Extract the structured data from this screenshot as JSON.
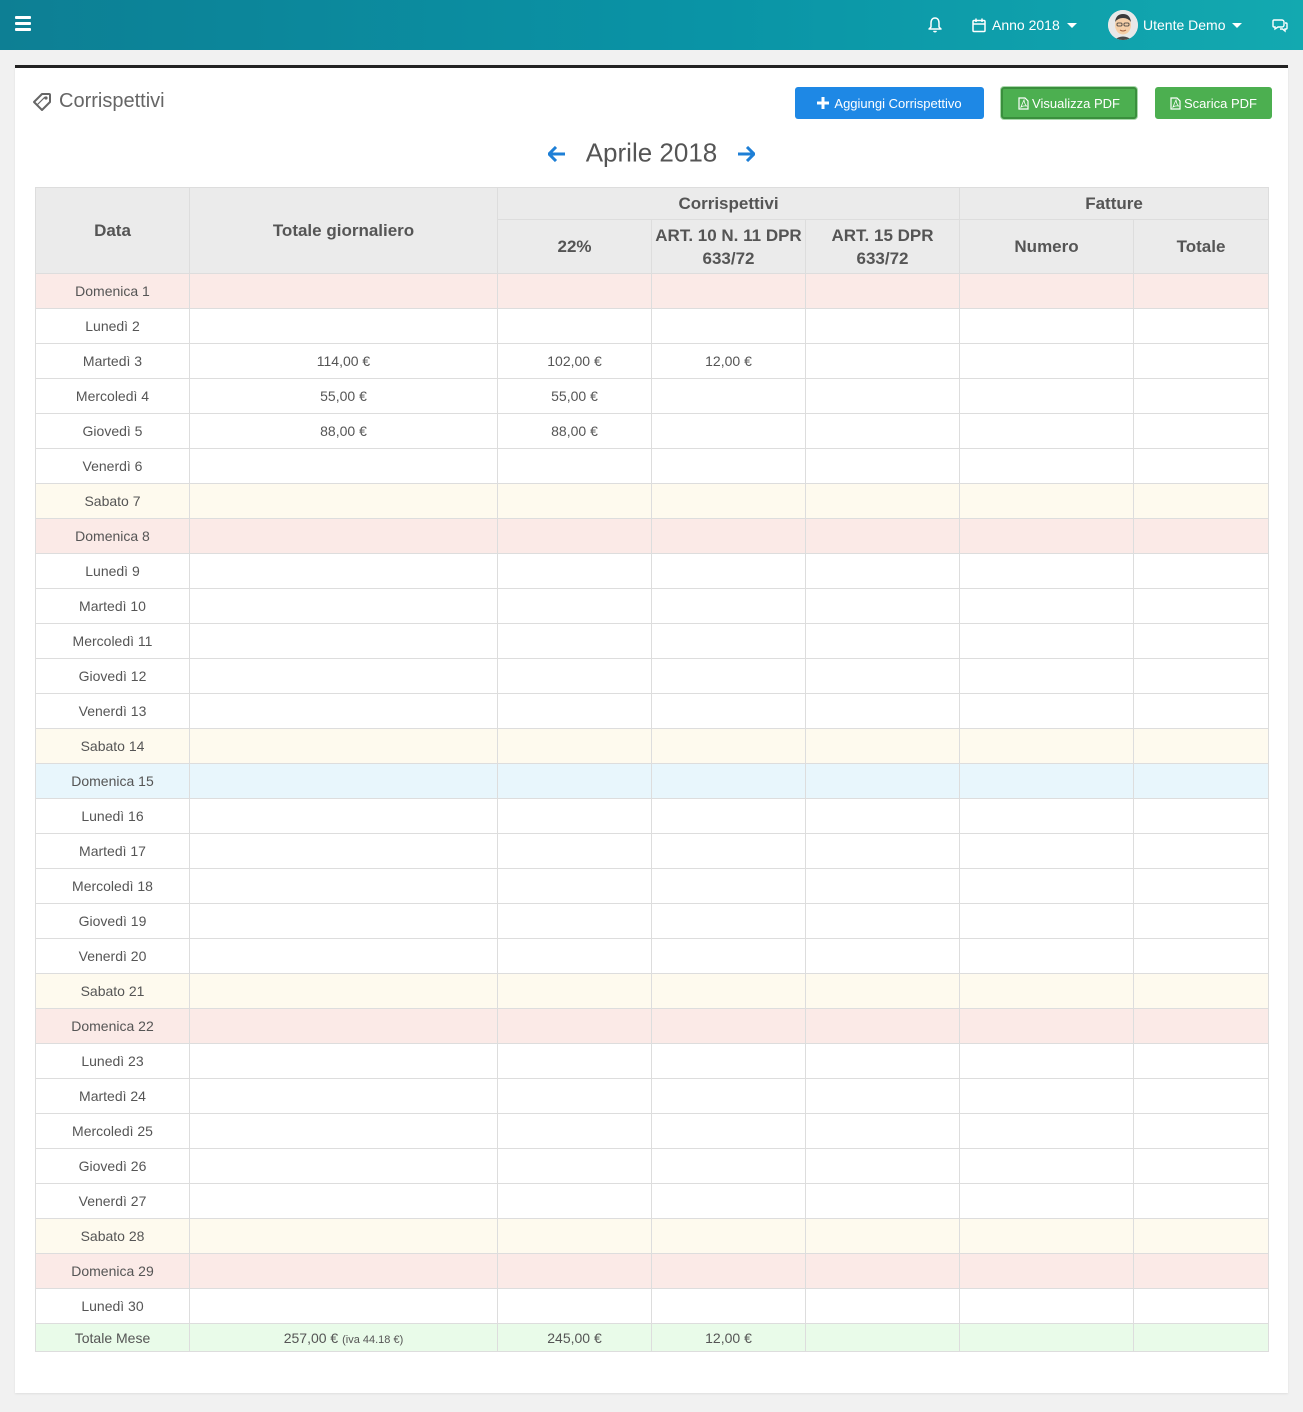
{
  "topbar": {
    "year_label": "Anno 2018",
    "user_name": "Utente Demo"
  },
  "page": {
    "title": "Corrispettivi",
    "buttons": {
      "add": "Aggiungi Corrispettivo",
      "view_pdf": "Visualizza PDF",
      "download_pdf": "Scarica PDF"
    },
    "month": "Aprile 2018"
  },
  "table": {
    "headers": {
      "data": "Data",
      "totale_giornaliero": "Totale giornaliero",
      "corrispettivi": "Corrispettivi",
      "fatture": "Fatture",
      "iva22": "22%",
      "art10": "ART. 10 N. 11 DPR 633/72",
      "art15": "ART. 15 DPR 633/72",
      "numero": "Numero",
      "totale": "Totale"
    },
    "rows": [
      {
        "day": "Domenica 1",
        "type": "sunday",
        "totale": "",
        "iva22": "",
        "art10": "",
        "art15": "",
        "numero": "",
        "fatt_totale": ""
      },
      {
        "day": "Lunedì 2",
        "type": "weekday",
        "totale": "",
        "iva22": "",
        "art10": "",
        "art15": "",
        "numero": "",
        "fatt_totale": ""
      },
      {
        "day": "Martedì 3",
        "type": "weekday",
        "totale": "114,00 €",
        "iva22": "102,00 €",
        "art10": "12,00 €",
        "art15": "",
        "numero": "",
        "fatt_totale": ""
      },
      {
        "day": "Mercoledì 4",
        "type": "weekday",
        "totale": "55,00 €",
        "iva22": "55,00 €",
        "art10": "",
        "art15": "",
        "numero": "",
        "fatt_totale": ""
      },
      {
        "day": "Giovedì 5",
        "type": "weekday",
        "totale": "88,00 €",
        "iva22": "88,00 €",
        "art10": "",
        "art15": "",
        "numero": "",
        "fatt_totale": ""
      },
      {
        "day": "Venerdì 6",
        "type": "weekday",
        "totale": "",
        "iva22": "",
        "art10": "",
        "art15": "",
        "numero": "",
        "fatt_totale": ""
      },
      {
        "day": "Sabato 7",
        "type": "saturday",
        "totale": "",
        "iva22": "",
        "art10": "",
        "art15": "",
        "numero": "",
        "fatt_totale": ""
      },
      {
        "day": "Domenica 8",
        "type": "sunday",
        "totale": "",
        "iva22": "",
        "art10": "",
        "art15": "",
        "numero": "",
        "fatt_totale": ""
      },
      {
        "day": "Lunedì 9",
        "type": "weekday",
        "totale": "",
        "iva22": "",
        "art10": "",
        "art15": "",
        "numero": "",
        "fatt_totale": ""
      },
      {
        "day": "Martedì 10",
        "type": "weekday",
        "totale": "",
        "iva22": "",
        "art10": "",
        "art15": "",
        "numero": "",
        "fatt_totale": ""
      },
      {
        "day": "Mercoledì 11",
        "type": "weekday",
        "totale": "",
        "iva22": "",
        "art10": "",
        "art15": "",
        "numero": "",
        "fatt_totale": ""
      },
      {
        "day": "Giovedì 12",
        "type": "weekday",
        "totale": "",
        "iva22": "",
        "art10": "",
        "art15": "",
        "numero": "",
        "fatt_totale": ""
      },
      {
        "day": "Venerdì 13",
        "type": "weekday",
        "totale": "",
        "iva22": "",
        "art10": "",
        "art15": "",
        "numero": "",
        "fatt_totale": ""
      },
      {
        "day": "Sabato 14",
        "type": "saturday",
        "totale": "",
        "iva22": "",
        "art10": "",
        "art15": "",
        "numero": "",
        "fatt_totale": ""
      },
      {
        "day": "Domenica 15",
        "type": "holiday",
        "totale": "",
        "iva22": "",
        "art10": "",
        "art15": "",
        "numero": "",
        "fatt_totale": ""
      },
      {
        "day": "Lunedì 16",
        "type": "weekday",
        "totale": "",
        "iva22": "",
        "art10": "",
        "art15": "",
        "numero": "",
        "fatt_totale": ""
      },
      {
        "day": "Martedì 17",
        "type": "weekday",
        "totale": "",
        "iva22": "",
        "art10": "",
        "art15": "",
        "numero": "",
        "fatt_totale": ""
      },
      {
        "day": "Mercoledì 18",
        "type": "weekday",
        "totale": "",
        "iva22": "",
        "art10": "",
        "art15": "",
        "numero": "",
        "fatt_totale": ""
      },
      {
        "day": "Giovedì 19",
        "type": "weekday",
        "totale": "",
        "iva22": "",
        "art10": "",
        "art15": "",
        "numero": "",
        "fatt_totale": ""
      },
      {
        "day": "Venerdì 20",
        "type": "weekday",
        "totale": "",
        "iva22": "",
        "art10": "",
        "art15": "",
        "numero": "",
        "fatt_totale": ""
      },
      {
        "day": "Sabato 21",
        "type": "saturday",
        "totale": "",
        "iva22": "",
        "art10": "",
        "art15": "",
        "numero": "",
        "fatt_totale": ""
      },
      {
        "day": "Domenica 22",
        "type": "sunday",
        "totale": "",
        "iva22": "",
        "art10": "",
        "art15": "",
        "numero": "",
        "fatt_totale": ""
      },
      {
        "day": "Lunedì 23",
        "type": "weekday",
        "totale": "",
        "iva22": "",
        "art10": "",
        "art15": "",
        "numero": "",
        "fatt_totale": ""
      },
      {
        "day": "Martedì 24",
        "type": "weekday",
        "totale": "",
        "iva22": "",
        "art10": "",
        "art15": "",
        "numero": "",
        "fatt_totale": ""
      },
      {
        "day": "Mercoledì 25",
        "type": "weekday",
        "totale": "",
        "iva22": "",
        "art10": "",
        "art15": "",
        "numero": "",
        "fatt_totale": ""
      },
      {
        "day": "Giovedì 26",
        "type": "weekday",
        "totale": "",
        "iva22": "",
        "art10": "",
        "art15": "",
        "numero": "",
        "fatt_totale": ""
      },
      {
        "day": "Venerdì 27",
        "type": "weekday",
        "totale": "",
        "iva22": "",
        "art10": "",
        "art15": "",
        "numero": "",
        "fatt_totale": ""
      },
      {
        "day": "Sabato 28",
        "type": "saturday",
        "totale": "",
        "iva22": "",
        "art10": "",
        "art15": "",
        "numero": "",
        "fatt_totale": ""
      },
      {
        "day": "Domenica 29",
        "type": "sunday",
        "totale": "",
        "iva22": "",
        "art10": "",
        "art15": "",
        "numero": "",
        "fatt_totale": ""
      },
      {
        "day": "Lunedì 30",
        "type": "weekday",
        "totale": "",
        "iva22": "",
        "art10": "",
        "art15": "",
        "numero": "",
        "fatt_totale": ""
      }
    ],
    "footer": {
      "label": "Totale Mese",
      "totale": "257,00 €",
      "iva_note": "(iva 44.18 €)",
      "iva22": "245,00 €",
      "art10": "12,00 €",
      "art15": "",
      "numero": "",
      "fatt_totale": ""
    }
  },
  "colors": {
    "topbar_start": "#0d7f94",
    "topbar_end": "#13a9b0",
    "primary_button": "#1e88e5",
    "success_button": "#4caf50",
    "sunday_row": "#fbeae7",
    "saturday_row": "#fefaee",
    "holiday_row": "#e8f6fc",
    "total_row": "#e9fbe9"
  },
  "icons": {
    "menu": "hamburger-icon",
    "notifications": "bell-icon",
    "calendar": "calendar-icon",
    "chat": "comments-icon",
    "title": "tag-icon",
    "add": "plus-icon",
    "pdf": "file-pdf-icon",
    "prev": "arrow-left-icon",
    "next": "arrow-right-icon"
  }
}
